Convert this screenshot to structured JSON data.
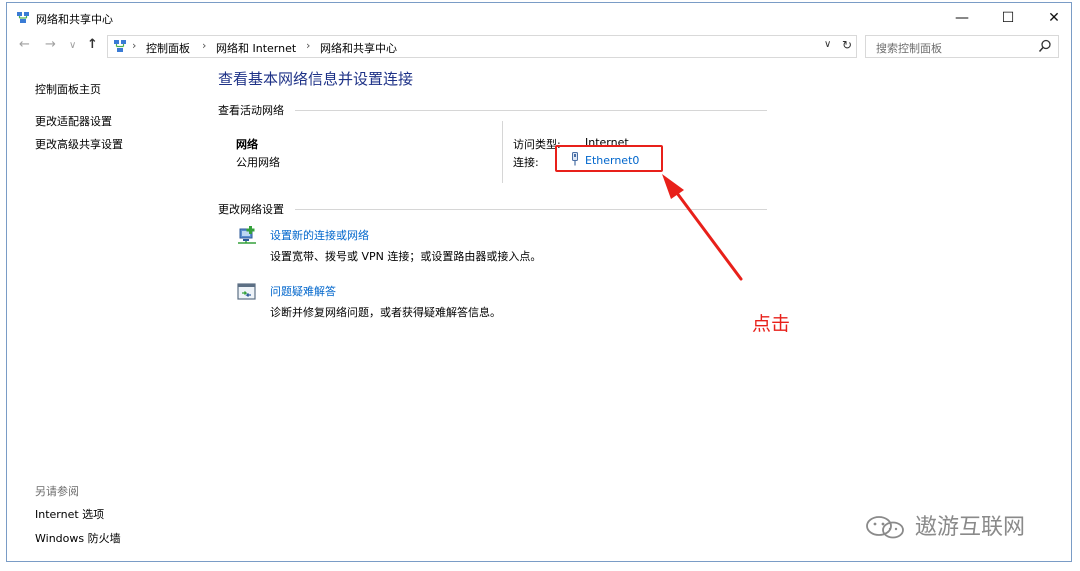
{
  "window": {
    "title": "网络和共享中心",
    "controls": {
      "minimize": "—",
      "maximize": "☐",
      "close": "✕"
    }
  },
  "navigation": {
    "back": "←",
    "forward": "→",
    "recent": "∨",
    "up": "↑",
    "breadcrumb": [
      "控制面板",
      "网络和 Internet",
      "网络和共享中心"
    ],
    "separator": "›",
    "dropdown": "∨",
    "refresh": "↻",
    "search_placeholder": "搜索控制面板"
  },
  "left_pane": {
    "links": [
      "控制面板主页",
      "更改适配器设置",
      "更改高级共享设置"
    ],
    "see_also_heading": "另请参阅",
    "see_also_links": [
      "Internet 选项",
      "Windows 防火墙"
    ]
  },
  "main": {
    "title": "查看基本网络信息并设置连接",
    "active_section": "查看活动网络",
    "network_name": "网络",
    "network_type": "公用网络",
    "access_type_label": "访问类型:",
    "access_type_value": "Internet",
    "connection_label": "连接:",
    "connection_link": "Ethernet0",
    "change_section": "更改网络设置",
    "tasks": [
      {
        "link": "设置新的连接或网络",
        "description": "设置宽带、拨号或 VPN 连接；或设置路由器或接入点。",
        "icon": "network-setup-icon"
      },
      {
        "link": "问题疑难解答",
        "description": "诊断并修复网络问题，或者获得疑难解答信息。",
        "icon": "troubleshoot-icon"
      }
    ]
  },
  "annotation": {
    "text": "点击",
    "color": "#e8201a"
  },
  "watermark": {
    "text": "遨游互联网",
    "icon": "wechat-icon"
  },
  "colors": {
    "link": "#0066cc",
    "title": "#1e3287",
    "annotation": "#e8201a",
    "border": "#7a9cc6"
  }
}
